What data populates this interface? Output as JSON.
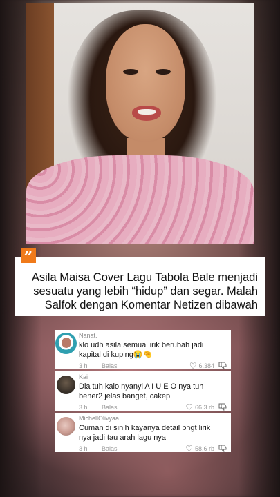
{
  "caption": {
    "quote_icon": "”",
    "text": "Asila Maisa Cover Lagu Tabola Bale menjadi sesuatu yang lebih “hidup” dan segar. Malah Salfok dengan Komentar Netizen dibawah"
  },
  "comments": [
    {
      "username": "Nanat.",
      "text": "klo udh asila semua lirik berubah jadi kapital di kuping😭🤏",
      "time": "3 h",
      "reply_label": "Balas",
      "likes": "6.384"
    },
    {
      "username": "Kai",
      "text": "Dia tuh kalo nyanyi A I U E O nya tuh bener2 jelas banget, cakep",
      "time": "3 h",
      "reply_label": "Balas",
      "likes": "66,3 rb"
    },
    {
      "username": "MichellOlivyaa",
      "text": "Cuman di sinih kayanya detail bngt lirik nya jadi tau arah lagu nya",
      "time": "3 h",
      "reply_label": "Balas",
      "likes": "58,6 rb"
    }
  ],
  "colors": {
    "quote_badge": "#f07a1a",
    "card": "#ffffff"
  }
}
